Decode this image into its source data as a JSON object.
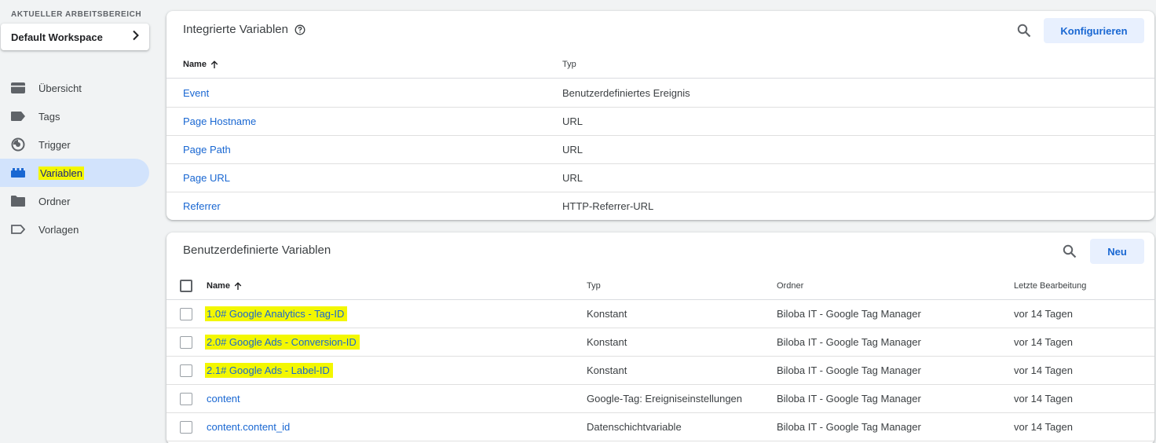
{
  "sidebar": {
    "workspace_label": "AKTUELLER ARBEITSBEREICH",
    "workspace_name": "Default Workspace",
    "items": [
      {
        "label": "Übersicht",
        "icon": "overview-icon"
      },
      {
        "label": "Tags",
        "icon": "tag-icon"
      },
      {
        "label": "Trigger",
        "icon": "trigger-icon"
      },
      {
        "label": "Variablen",
        "icon": "variables-icon",
        "active": true,
        "highlighted": true
      },
      {
        "label": "Ordner",
        "icon": "folder-icon"
      },
      {
        "label": "Vorlagen",
        "icon": "template-icon"
      }
    ]
  },
  "builtin": {
    "title": "Integrierte Variablen",
    "configure_label": "Konfigurieren",
    "columns": {
      "name": "Name",
      "type": "Typ"
    },
    "rows": [
      {
        "name": "Event",
        "type": "Benutzerdefiniertes Ereignis"
      },
      {
        "name": "Page Hostname",
        "type": "URL"
      },
      {
        "name": "Page Path",
        "type": "URL"
      },
      {
        "name": "Page URL",
        "type": "URL"
      },
      {
        "name": "Referrer",
        "type": "HTTP-Referrer-URL"
      }
    ]
  },
  "custom": {
    "title": "Benutzerdefinierte Variablen",
    "new_label": "Neu",
    "columns": {
      "name": "Name",
      "type": "Typ",
      "folder": "Ordner",
      "edited": "Letzte Bearbeitung"
    },
    "rows": [
      {
        "name": "1.0# Google Analytics - Tag-ID",
        "type": "Konstant",
        "folder": "Biloba IT - Google Tag Manager",
        "edited": "vor 14 Tagen",
        "highlighted": true
      },
      {
        "name": "2.0# Google Ads - Conversion-ID",
        "type": "Konstant",
        "folder": "Biloba IT - Google Tag Manager",
        "edited": "vor 14 Tagen",
        "highlighted": true
      },
      {
        "name": "2.1# Google Ads - Label-ID",
        "type": "Konstant",
        "folder": "Biloba IT - Google Tag Manager",
        "edited": "vor 14 Tagen",
        "highlighted": true
      },
      {
        "name": "content",
        "type": "Google-Tag: Ereigniseinstellungen",
        "folder": "Biloba IT - Google Tag Manager",
        "edited": "vor 14 Tagen",
        "highlighted": false
      },
      {
        "name": "content.content_id",
        "type": "Datenschichtvariable",
        "folder": "Biloba IT - Google Tag Manager",
        "edited": "vor 14 Tagen",
        "highlighted": false
      }
    ]
  },
  "colors": {
    "accent": "#1967d2",
    "highlight": "#f3f700",
    "active_nav_bg": "#d2e3fc",
    "button_bg": "#e8f0fe"
  }
}
